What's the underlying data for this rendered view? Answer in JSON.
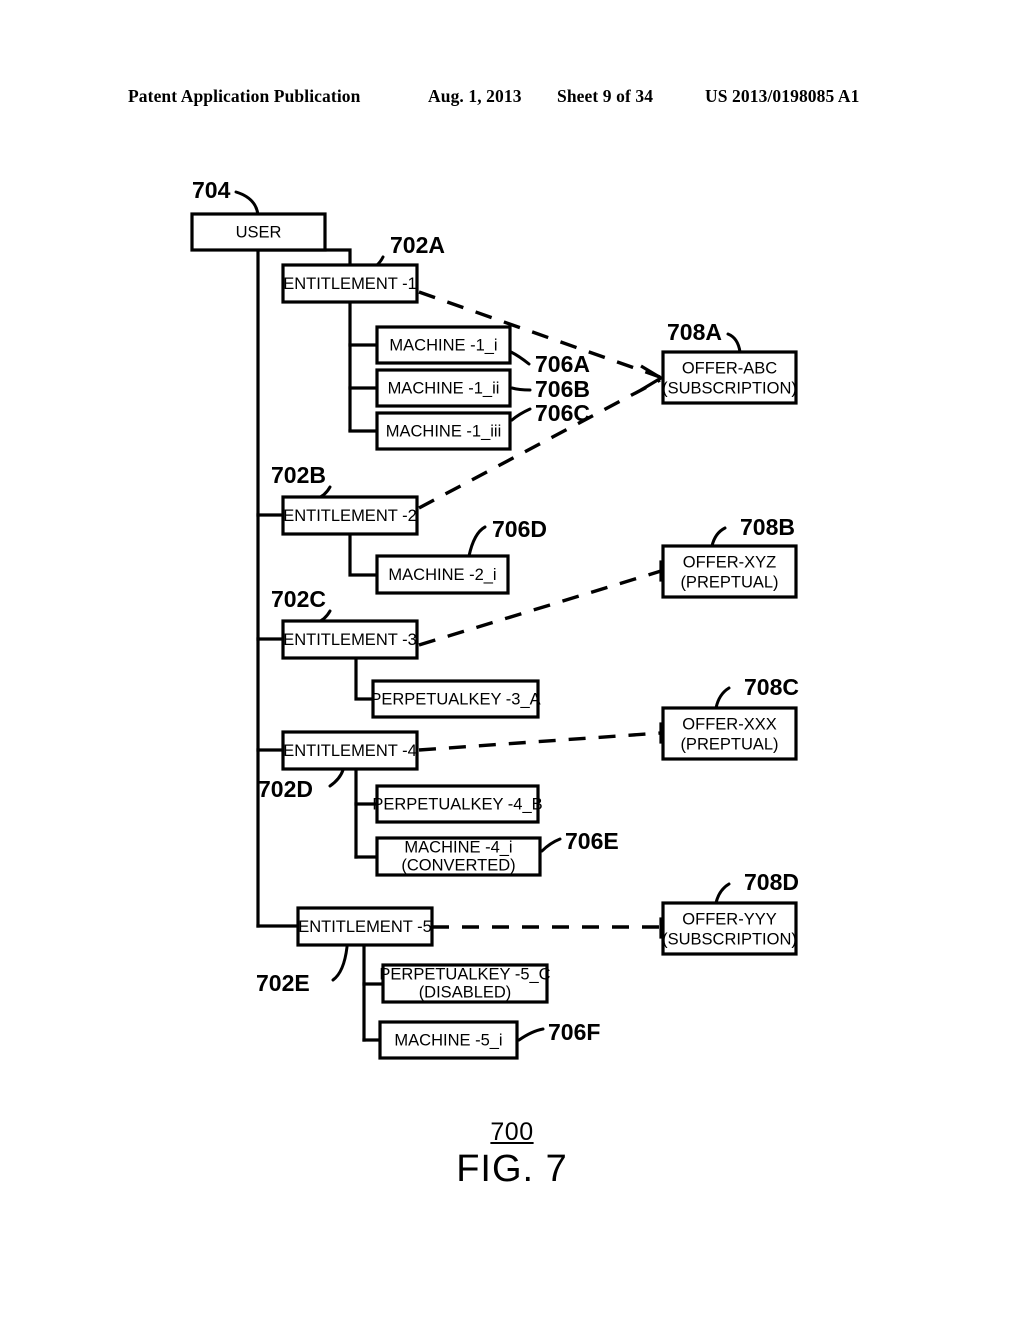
{
  "header": {
    "publication": "Patent Application Publication",
    "date": "Aug. 1, 2013",
    "sheet": "Sheet 9 of 34",
    "patent_number": "US 2013/0198085 A1"
  },
  "figure": {
    "number_label": "700",
    "title": "FIG. 7"
  },
  "nodes": {
    "user": {
      "ref": "704",
      "label": "USER"
    },
    "entitlement1": {
      "ref": "702A",
      "label": "ENTITLEMENT -1"
    },
    "entitlement2": {
      "ref": "702B",
      "label": "ENTITLEMENT -2"
    },
    "entitlement3": {
      "ref": "702C",
      "label": "ENTITLEMENT -3"
    },
    "entitlement4": {
      "ref": "702D",
      "label": "ENTITLEMENT -4"
    },
    "entitlement5": {
      "ref": "702E",
      "label": "ENTITLEMENT -5"
    },
    "machine1i": {
      "ref": "706A",
      "label": "MACHINE -1_i"
    },
    "machine1ii": {
      "ref": "706B",
      "label": "MACHINE -1_ii"
    },
    "machine1iii": {
      "ref": "706C",
      "label": "MACHINE -1_iii"
    },
    "machine2i": {
      "ref": "706D",
      "label": "MACHINE -2_i"
    },
    "machine4i": {
      "ref": "706E",
      "label_line1": "MACHINE -4_i",
      "label_line2": "(CONVERTED)"
    },
    "machine5i": {
      "ref": "706F",
      "label": "MACHINE -5_i"
    },
    "perpetualkey3a": {
      "label": "PERPETUALKEY -3_A"
    },
    "perpetualkey4b": {
      "label": "PERPETUALKEY -4_B"
    },
    "perpetualkey5c": {
      "label_line1": "PERPETUALKEY -5_C",
      "label_line2": "(DISABLED)"
    },
    "offerAbc": {
      "ref": "708A",
      "label_line1": "OFFER-ABC",
      "label_line2": "(SUBSCRIPTION)"
    },
    "offerXyz": {
      "ref": "708B",
      "label_line1": "OFFER-XYZ",
      "label_line2": "(PREPTUAL)"
    },
    "offerXxx": {
      "ref": "708C",
      "label_line1": "OFFER-XXX",
      "label_line2": "(PREPTUAL)"
    },
    "offerYyy": {
      "ref": "708D",
      "label_line1": "OFFER-YYY",
      "label_line2": "(SUBSCRIPTION)"
    }
  },
  "colors": {
    "stroke": "#000000",
    "fill": "#ffffff"
  }
}
